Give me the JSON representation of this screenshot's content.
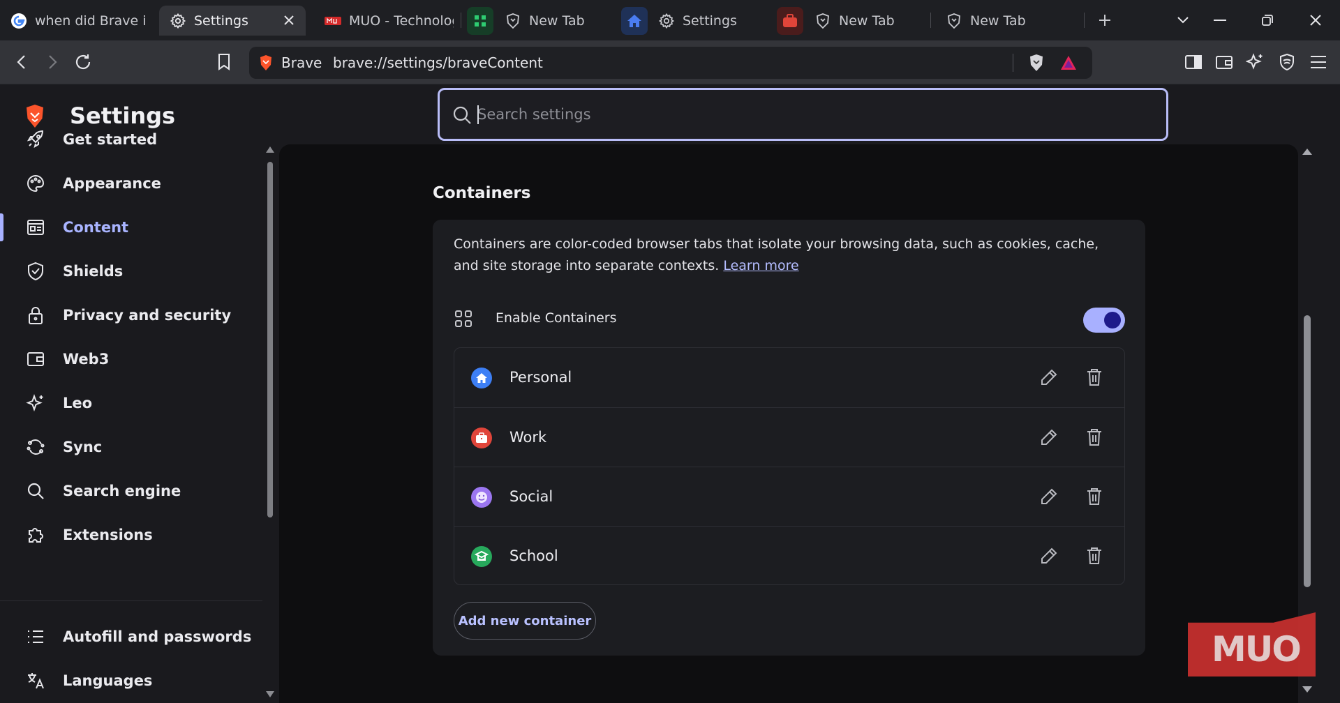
{
  "tabs": [
    {
      "title": "when did Brave int",
      "icon": "google-icon"
    },
    {
      "title": "Settings",
      "icon": "gear-icon",
      "active": true
    },
    {
      "title": "MUO - Technology",
      "icon": "muo-icon"
    },
    {
      "title": "New Tab",
      "icon": "brave-shield-icon",
      "group_color": "#2ecc71"
    },
    {
      "title": "Settings",
      "icon": "gear-icon",
      "group_color": "#4a7cf0"
    },
    {
      "title": "New Tab",
      "icon": "brave-shield-icon",
      "group_color": "#e0453a"
    },
    {
      "title": "New Tab",
      "icon": "brave-shield-icon"
    }
  ],
  "omnibox": {
    "brand": "Brave",
    "url": "brave://settings/braveContent"
  },
  "sidebar": {
    "title": "Settings",
    "items": [
      {
        "label": "Get started",
        "icon": "rocket-icon"
      },
      {
        "label": "Appearance",
        "icon": "palette-icon"
      },
      {
        "label": "Content",
        "icon": "content-icon",
        "active": true
      },
      {
        "label": "Shields",
        "icon": "shield-icon"
      },
      {
        "label": "Privacy and security",
        "icon": "lock-icon"
      },
      {
        "label": "Web3",
        "icon": "wallet-icon"
      },
      {
        "label": "Leo",
        "icon": "leo-sparkle-icon"
      },
      {
        "label": "Sync",
        "icon": "sync-icon"
      },
      {
        "label": "Search engine",
        "icon": "search-icon"
      },
      {
        "label": "Extensions",
        "icon": "puzzle-icon"
      },
      {
        "label": "Autofill and passwords",
        "icon": "list-icon"
      },
      {
        "label": "Languages",
        "icon": "translate-icon"
      }
    ]
  },
  "search": {
    "placeholder": "Search settings"
  },
  "containers": {
    "section_title": "Containers",
    "description": "Containers are color-coded browser tabs that isolate your browsing data, such as cookies, cache, and site storage into separate contexts.",
    "learn_more": "Learn more",
    "enable_label": "Enable Containers",
    "enabled": true,
    "items": [
      {
        "name": "Personal",
        "icon": "home-icon",
        "color": "#3d7ff5"
      },
      {
        "name": "Work",
        "icon": "briefcase-icon",
        "color": "#e0453a"
      },
      {
        "name": "Social",
        "icon": "smiley-icon",
        "color": "#9b76f0"
      },
      {
        "name": "School",
        "icon": "graduation-cap-icon",
        "color": "#27a95c"
      }
    ],
    "add_button": "Add new container"
  },
  "watermark": "MUO",
  "colors": {
    "accent": "#a8b1ff",
    "toggle_knob": "#1e1a8a",
    "watermark": "#c9302f"
  }
}
